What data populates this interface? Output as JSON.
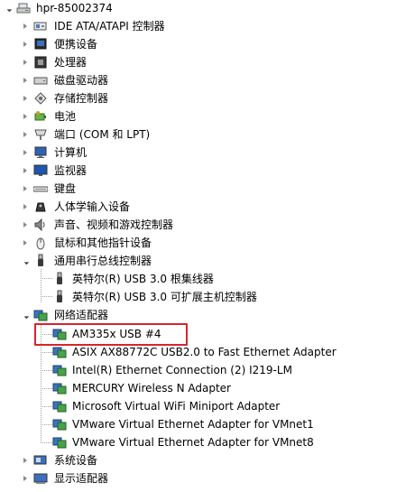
{
  "root": {
    "label": "hpr-85002374",
    "icon": "computer-root-icon"
  },
  "categories": [
    {
      "label": "IDE ATA/ATAPI 控制器",
      "icon": "ide-controller-icon"
    },
    {
      "label": "便携设备",
      "icon": "portable-device-icon"
    },
    {
      "label": "处理器",
      "icon": "processor-icon"
    },
    {
      "label": "磁盘驱动器",
      "icon": "disk-drive-icon"
    },
    {
      "label": "存储控制器",
      "icon": "storage-controller-icon"
    },
    {
      "label": "电池",
      "icon": "battery-icon"
    },
    {
      "label": "端口 (COM 和 LPT)",
      "icon": "port-icon"
    },
    {
      "label": "计算机",
      "icon": "computer-icon"
    },
    {
      "label": "监视器",
      "icon": "monitor-icon"
    },
    {
      "label": "键盘",
      "icon": "keyboard-icon"
    },
    {
      "label": "人体学输入设备",
      "icon": "hid-icon"
    },
    {
      "label": "声音、视频和游戏控制器",
      "icon": "sound-icon"
    },
    {
      "label": "鼠标和其他指针设备",
      "icon": "mouse-icon"
    }
  ],
  "usb": {
    "label": "通用串行总线控制器",
    "icon": "usb-icon",
    "children": [
      {
        "label": "英特尔(R) USB 3.0 根集线器",
        "icon": "usb-device-icon"
      },
      {
        "label": "英特尔(R) USB 3.0 可扩展主机控制器",
        "icon": "usb-device-icon"
      }
    ]
  },
  "network": {
    "label": "网络适配器",
    "icon": "network-adapter-icon",
    "children": [
      {
        "label": "AM335x USB #4",
        "icon": "network-adapter-icon"
      },
      {
        "label": "ASIX AX88772C USB2.0 to Fast Ethernet Adapter",
        "icon": "network-adapter-icon"
      },
      {
        "label": "Intel(R) Ethernet Connection (2) I219-LM",
        "icon": "network-adapter-icon"
      },
      {
        "label": "MERCURY Wireless N Adapter",
        "icon": "network-adapter-icon"
      },
      {
        "label": "Microsoft Virtual WiFi Miniport Adapter",
        "icon": "network-adapter-icon"
      },
      {
        "label": "VMware Virtual Ethernet Adapter for VMnet1",
        "icon": "network-adapter-icon"
      },
      {
        "label": "VMware Virtual Ethernet Adapter for VMnet8",
        "icon": "network-adapter-icon"
      }
    ]
  },
  "tail": [
    {
      "label": "系统设备",
      "icon": "system-device-icon"
    },
    {
      "label": "显示适配器",
      "icon": "display-adapter-icon"
    }
  ],
  "highlight_color": "#d6242d"
}
